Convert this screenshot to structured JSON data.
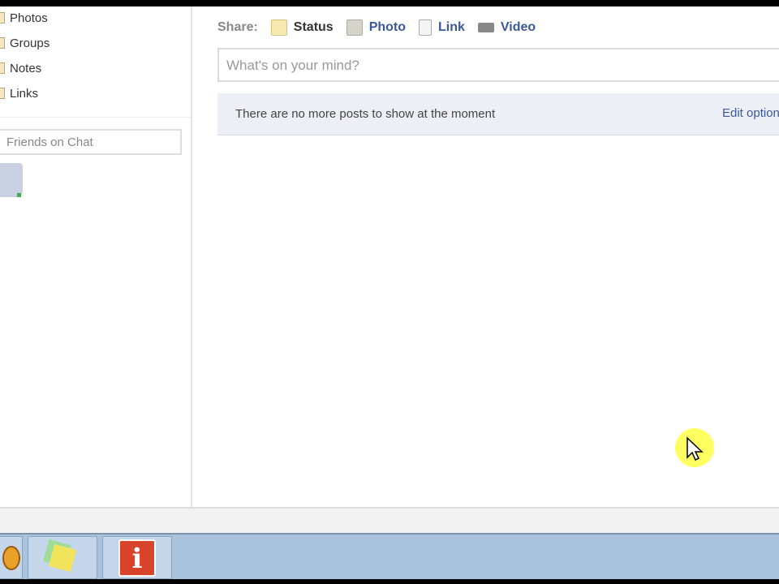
{
  "sidebar": {
    "items": [
      {
        "label": "Photos"
      },
      {
        "label": "Groups"
      },
      {
        "label": "Notes"
      },
      {
        "label": "Links"
      }
    ],
    "chat_label": "Friends on Chat"
  },
  "share": {
    "label": "Share:",
    "options": [
      {
        "label": "Status",
        "icon": "status-icon",
        "active": true
      },
      {
        "label": "Photo",
        "icon": "photo-icon"
      },
      {
        "label": "Link",
        "icon": "link-icon"
      },
      {
        "label": "Video",
        "icon": "video-icon"
      }
    ]
  },
  "composer": {
    "placeholder": "What's on your mind?"
  },
  "feed": {
    "notice": "There are no more posts to show at the moment",
    "edit_options": "Edit options"
  },
  "taskbar": {
    "apps": [
      "browser-icon",
      "sticky-notes-icon",
      "info-video-icon"
    ]
  },
  "colors": {
    "link": "#3b5998",
    "taskbar": "#a9c2de"
  }
}
